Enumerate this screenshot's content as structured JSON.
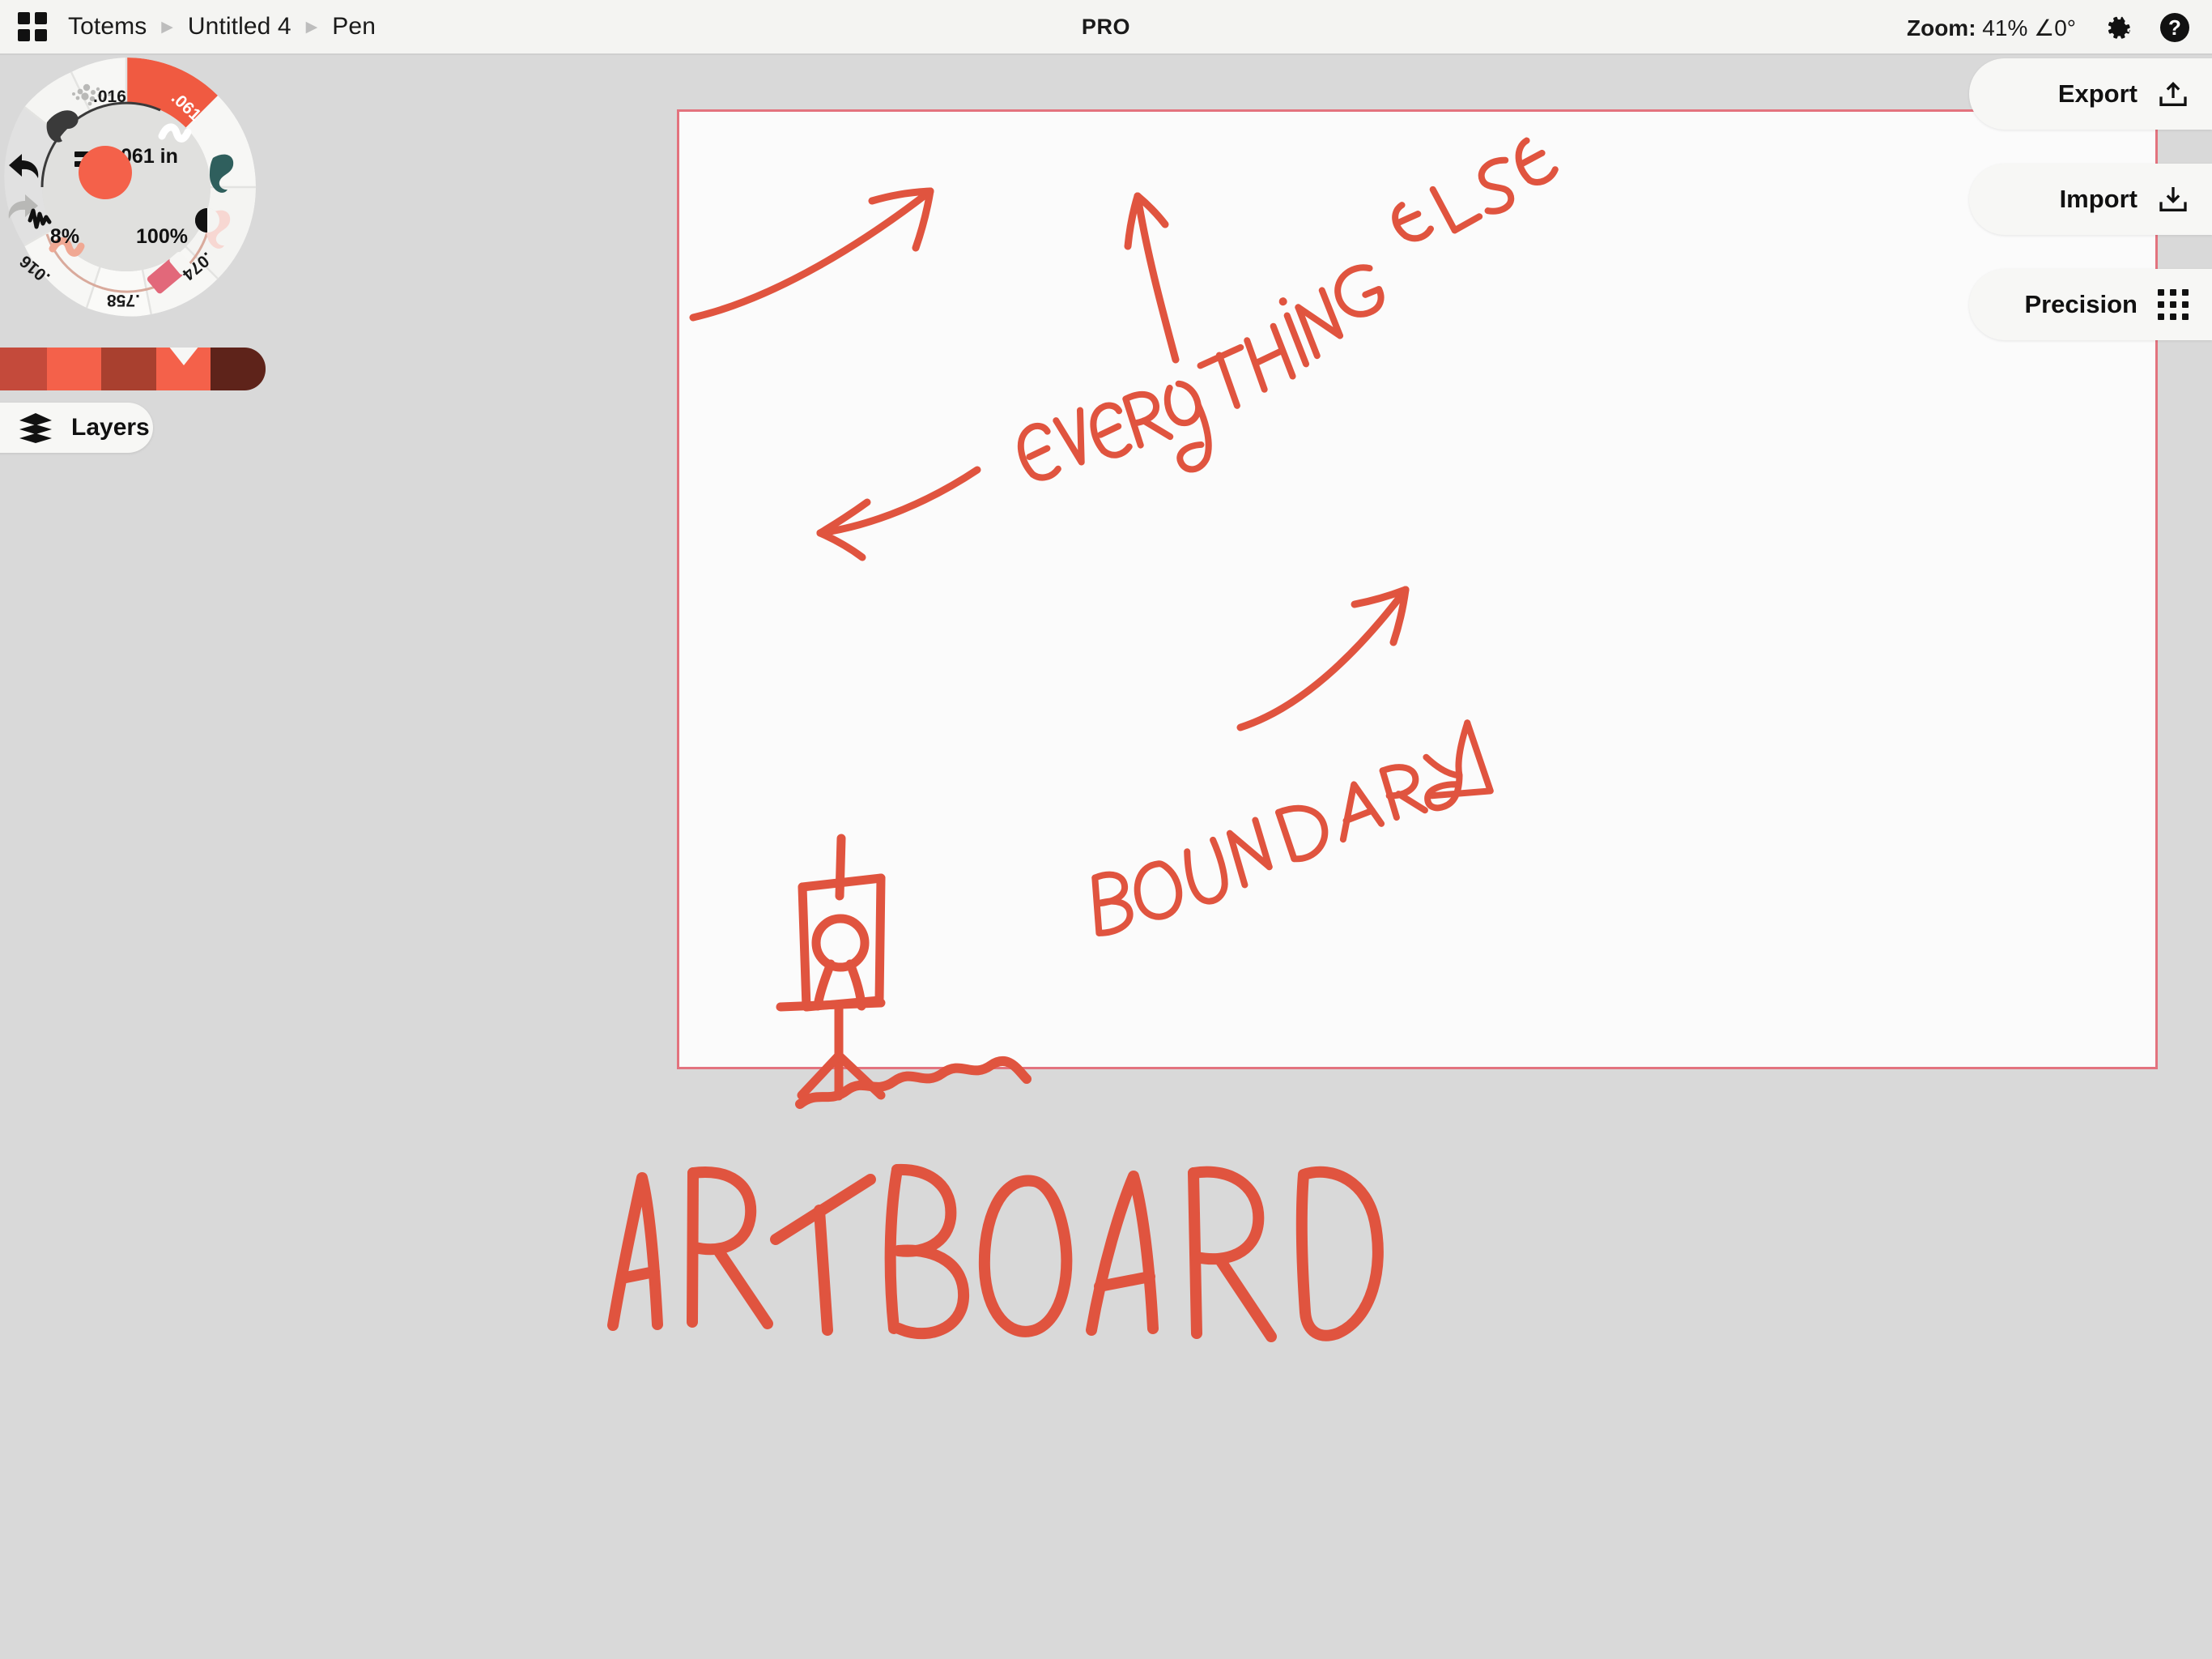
{
  "topbar": {
    "grid_icon": "apps-grid-icon",
    "breadcrumb": [
      {
        "label": "Totems"
      },
      {
        "label": "Untitled 4"
      },
      {
        "label": "Pen"
      }
    ],
    "separator": "▶",
    "pro_badge": "PRO",
    "zoom_prefix": "Zoom:",
    "zoom_value": "41%",
    "angle_value": "∠0°",
    "settings_icon": "gear-icon",
    "help_icon": "help-question-icon"
  },
  "toolwheel": {
    "size_readout": ".061 in",
    "opacity_left": "8%",
    "opacity_right": "100%",
    "active_color": "#f4614a",
    "segments": [
      {
        "label": ".016",
        "kind": "spray-brush",
        "active": false
      },
      {
        "label": ".061",
        "kind": "marker-brush",
        "active": true
      },
      {
        "label": ".074",
        "kind": "eraser-tool",
        "active": false
      },
      {
        "label": ".758",
        "kind": "blank-tool",
        "active": false
      },
      {
        "label": ".016",
        "kind": "light-marker-brush",
        "active": false
      }
    ],
    "jitter_icon": "waveform-icon",
    "contrast_icon": "contrast-half-circle-icon",
    "undo_icon": "undo-arrow-icon",
    "redo_icon": "redo-arrow-icon"
  },
  "colorbar": {
    "swatches": [
      {
        "hex": "#c44a3b",
        "selected": false
      },
      {
        "hex": "#f4614a",
        "selected": false
      },
      {
        "hex": "#a9402f",
        "selected": false
      },
      {
        "hex": "#f4614a",
        "selected": true
      },
      {
        "hex": "#5e231a",
        "selected": false
      }
    ]
  },
  "layers": {
    "label": "Layers",
    "icon": "layers-stack-icon"
  },
  "right_panel": {
    "items": [
      {
        "label": "Export",
        "icon": "upload-export-icon"
      },
      {
        "label": "Import",
        "icon": "download-import-icon"
      },
      {
        "label": "Precision",
        "icon": "precision-dot-grid-icon"
      }
    ]
  },
  "artboard": {
    "border_color": "#e3737e",
    "fill_color": "#fbfbfb",
    "ink_color": "#e0543f",
    "annotations": [
      {
        "name": "everything-else-label",
        "text": "EVERYTHING ELSE"
      },
      {
        "name": "boundary-label",
        "text": "BOUNDARY"
      },
      {
        "name": "artboard-label",
        "text": "ARTBOARD"
      }
    ],
    "sketch_items": [
      "arrow-up-left",
      "arrow-up-right",
      "arrow-left",
      "arrow-boundary-up-right",
      "easel-with-figure",
      "ground-scribble"
    ]
  }
}
